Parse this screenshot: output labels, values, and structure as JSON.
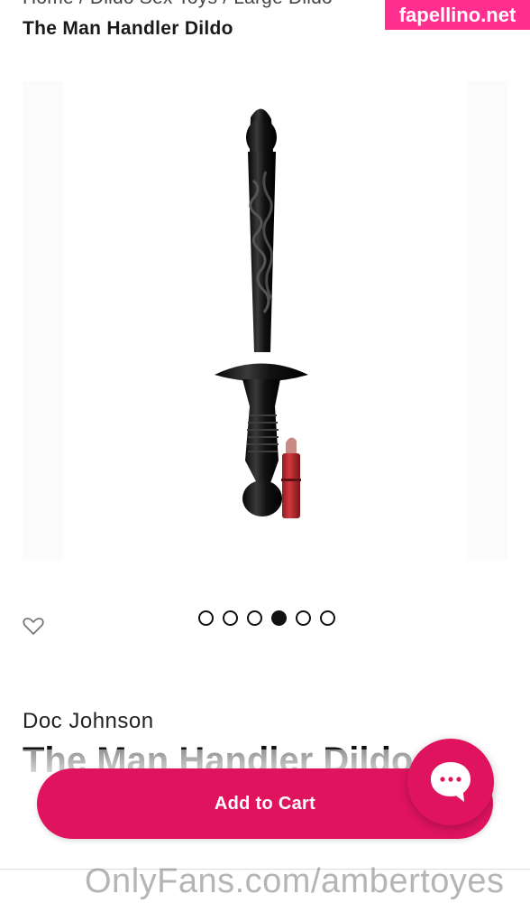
{
  "breadcrumb": {
    "items": [
      "Home",
      "Dildo Sex Toys",
      "Large Dildo"
    ],
    "separator": "/"
  },
  "page_title": "The Man Handler Dildo",
  "watermark_top": "fapellino.net",
  "gallery": {
    "image_icon": "dildo-product-image",
    "dot_count": 6,
    "active_dot_index": 3
  },
  "wishlist": {
    "icon": "heart-outline-icon"
  },
  "product": {
    "brand": "Doc Johnson",
    "name": "The Man Handler Dildo"
  },
  "cart": {
    "label": "Add to Cart"
  },
  "chat": {
    "icon": "chat-bubble-icon"
  },
  "watermark_bottom": "OnlyFans.com/ambertoyes",
  "colors": {
    "accent": "#e0135f",
    "watermark_bg": "#ff2e8f"
  }
}
